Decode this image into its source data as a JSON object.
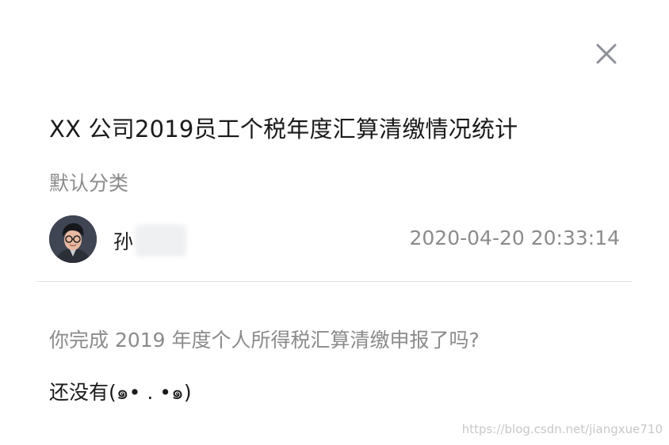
{
  "header": {
    "close_icon": "close-icon"
  },
  "post": {
    "title": "XX 公司2019员工个税年度汇算清缴情况统计",
    "category": "默认分类",
    "author": {
      "name": "孙",
      "avatar_icon": "avatar"
    },
    "timestamp": "2020-04-20 20:33:14"
  },
  "content": {
    "question": "你完成 2019 年度个人所得税汇算清缴申报了吗?",
    "answer": "还没有(๑• . •๑)"
  },
  "watermark": "https://blog.csdn.net/jiangxue710",
  "colors": {
    "text_primary": "#1a1a1a",
    "text_secondary": "#8b8b8b",
    "divider": "#dedede",
    "icon": "#8e9199"
  }
}
